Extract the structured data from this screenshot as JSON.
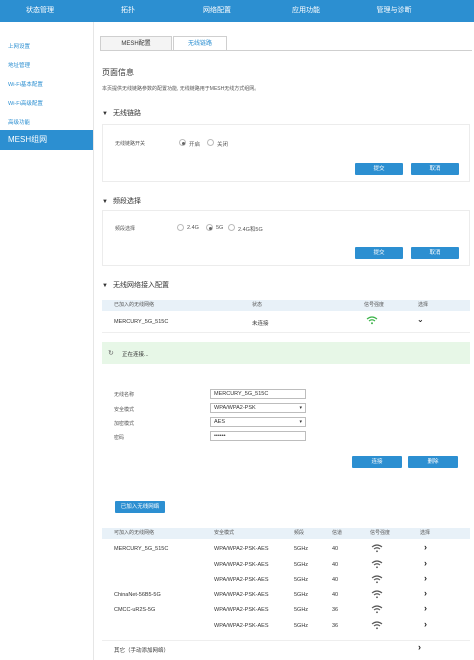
{
  "topnav": {
    "items": [
      "状态管理",
      "拓扑",
      "网络配置",
      "应用功能",
      "管理与诊断"
    ]
  },
  "sidebar": {
    "items": [
      "上网设置",
      "地址管理",
      "Wi-Fi基本配置",
      "Wi-Fi高级配置",
      "高级功能",
      "MESH组网"
    ]
  },
  "tabs": [
    "MESH配置",
    "无线链路"
  ],
  "page": {
    "title": "页面信息",
    "desc": "本页提供无线链路参数的配置功能, 无线链路用于MESH无线方式组网。"
  },
  "wireless_link": {
    "heading": "无线链路",
    "switch_label": "无线链路开关",
    "on": "开启",
    "off": "关闭",
    "submit": "提交",
    "cancel": "取消"
  },
  "band": {
    "heading": "频段选择",
    "label": "频段选择",
    "options": [
      "2.4G",
      "5G",
      "2.4G和5G"
    ],
    "submit": "提交",
    "cancel": "取消"
  },
  "access": {
    "heading": "无线网络接入配置",
    "joined_headers": [
      "已加入的无线网络",
      "状态",
      "信号强度",
      "选择"
    ],
    "joined_row": {
      "ssid": "MERCURY_5G_515C",
      "status": "未连接"
    },
    "connecting": "正在连接...",
    "form": {
      "ssid_label": "无线名称",
      "ssid_value": "MERCURY_5G_515C",
      "security_label": "安全模式",
      "security_value": "WPA/WPA2-PSK",
      "encrypt_label": "加密模式",
      "encrypt_value": "AES",
      "password_label": "密码",
      "password_value": "••••••"
    },
    "connect": "连接",
    "delete": "删除",
    "joined_button": "已加入无线网络",
    "available_headers": [
      "可加入的无线网络",
      "安全模式",
      "频段",
      "信道",
      "信号强度",
      "选择"
    ],
    "available_rows": [
      {
        "ssid": "MERCURY_5G_515C",
        "security": "WPA/WPA2-PSK-AES",
        "band": "5GHz",
        "channel": "40"
      },
      {
        "ssid": "",
        "security": "WPA/WPA2-PSK-AES",
        "band": "5GHz",
        "channel": "40"
      },
      {
        "ssid": "",
        "security": "WPA/WPA2-PSK-AES",
        "band": "5GHz",
        "channel": "40"
      },
      {
        "ssid": "ChinaNet-56B5-5G",
        "security": "WPA/WPA2-PSK-AES",
        "band": "5GHz",
        "channel": "40"
      },
      {
        "ssid": "CMCC-uR2S-5G",
        "security": "WPA/WPA2-PSK-AES",
        "band": "5GHz",
        "channel": "36"
      },
      {
        "ssid": "",
        "security": "WPA/WPA2-PSK-AES",
        "band": "5GHz",
        "channel": "36"
      }
    ],
    "other": "其它（手动添加网络）"
  },
  "colors": {
    "primary": "#2c8fd1",
    "signal_green": "#3cb44a",
    "connecting_bg": "#e7f7e7"
  }
}
